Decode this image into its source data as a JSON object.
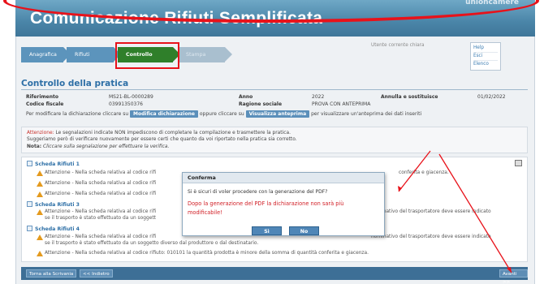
{
  "header": {
    "title": "Comunicazione Rifiuti Semplificata",
    "logo": "unioncamere"
  },
  "steps": [
    {
      "label": "Anagrafica"
    },
    {
      "label": "Rifiuti"
    },
    {
      "label": "Controllo"
    },
    {
      "label": "Stampa"
    }
  ],
  "user_text": "Utente corrente chiara",
  "side_menu": [
    "Help",
    "Esci",
    "Elenco"
  ],
  "section": {
    "title": "Controllo della pratica"
  },
  "info": {
    "riferimento_label": "Riferimento",
    "riferimento_value": "MS21-BL-0000289",
    "anno_label": "Anno",
    "anno_value": "2022",
    "annulla_label": "Annulla e sostituisce",
    "annulla_value": "01/02/2022",
    "codice_label": "Codice fiscale",
    "codice_value": "03991350376",
    "ragione_label": "Ragione sociale",
    "ragione_value": "PROVA CON ANTEPRIMA",
    "modify_prefix": "Per modificare la dichiarazione cliccare su",
    "modify_button": "Modifica dichiarazione",
    "or_text": "oppure cliccare su",
    "preview_button": "Visualizza anteprima",
    "preview_suffix": "per visualizzare un'anteprima dei dati inseriti"
  },
  "note": {
    "attention": "Attenzione:",
    "line1": "Le segnalazioni indicate NON impediscono di completare la compilazione e trasmettere la pratica.",
    "line2": "Suggeriamo però di verificare nuovamente per essere certi che quanto da voi riportato nella pratica sia corretto.",
    "nota_label": "Nota:",
    "nota_text": "Cliccare sulla segnalazione per effettuare la verifica."
  },
  "schede": [
    {
      "title": "Scheda Rifiuti 1"
    },
    {
      "title": "Scheda Rifiuti 3"
    },
    {
      "title": "Scheda Rifiuti 4"
    }
  ],
  "alerts": [
    {
      "text": "Attenzione - Nella scheda relativa al codice rifi",
      "tail": "conferita e giacenza."
    },
    {
      "text": "Attenzione - Nella scheda relativa al codice rifi",
      "tail": ""
    },
    {
      "text": "Attenzione - Nella scheda relativa al codice rifi",
      "tail": ""
    },
    {
      "text": "Attenzione - Nella scheda relativa al codice rifi",
      "tail": "nominativo del trasportatore deve essere indicato"
    },
    {
      "text": "se il trasporto è stato effettuato da un soggett",
      "tail": ""
    },
    {
      "text": "Attenzione - Nella scheda relativa al codice rifi",
      "tail": "nominativo del trasportatore deve essere indicato"
    },
    {
      "text": "se il trasporto è stato effettuato da un soggetto diverso dal produttore o dal destinatario.",
      "tail": ""
    },
    {
      "text": "Attenzione - Nella scheda relativa al codice rifiuto: 010101 la quantità prodotta è minore della somma di quantità conferita e giacenza.",
      "tail": ""
    }
  ],
  "bottom": {
    "back_label": "Torna alla Scrivania",
    "prev_label": "<< Indietro",
    "next_label": "Avanti >>"
  },
  "modal": {
    "title": "Conferma",
    "question": "Si è sicuri di voler procedere con la generazione del PDF?",
    "warning": "Dopo la generazione del PDF la dichiarazione non sarà più modificabile!",
    "yes_label": "Sì",
    "no_label": "No"
  },
  "colors": {
    "header": "#4a85a8",
    "active_step": "#2f7f2a",
    "annotation_red": "#e8121a",
    "link_blue": "#2d6fa6"
  }
}
